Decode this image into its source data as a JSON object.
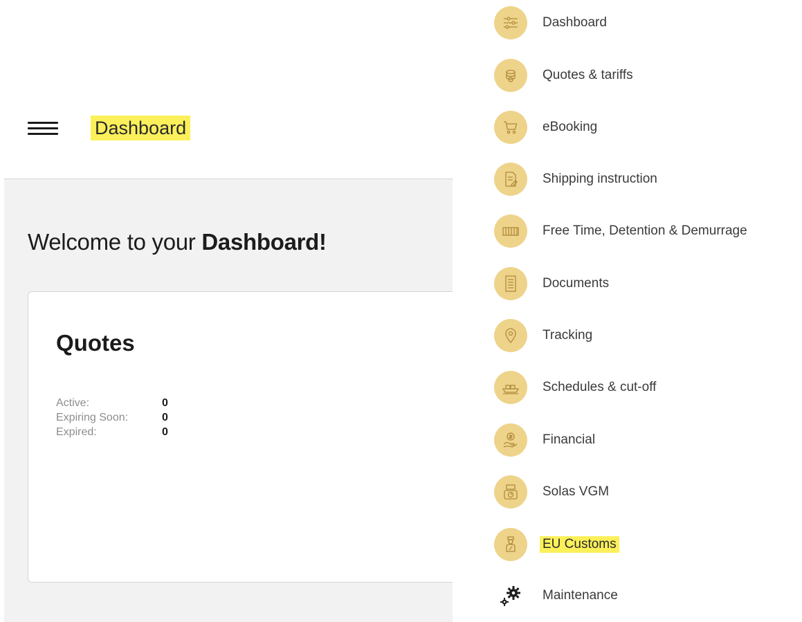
{
  "header": {
    "title": "Dashboard"
  },
  "welcome": {
    "prefix": "Welcome to your ",
    "emphasis": "Dashboard!"
  },
  "quotes_card": {
    "title": "Quotes",
    "stats": [
      {
        "label": "Active:",
        "value": "0"
      },
      {
        "label": "Expiring Soon:",
        "value": "0"
      },
      {
        "label": "Expired:",
        "value": "0"
      }
    ]
  },
  "menu": {
    "items": [
      {
        "label": "Dashboard",
        "icon": "sliders-icon"
      },
      {
        "label": "Quotes & tariffs",
        "icon": "coin-stack-icon"
      },
      {
        "label": "eBooking",
        "icon": "cart-icon"
      },
      {
        "label": "Shipping instruction",
        "icon": "document-edit-icon"
      },
      {
        "label": "Free Time, Detention & Demurrage",
        "icon": "container-icon"
      },
      {
        "label": "Documents",
        "icon": "documents-icon"
      },
      {
        "label": "Tracking",
        "icon": "location-pin-icon"
      },
      {
        "label": "Schedules & cut-off",
        "icon": "ship-icon"
      },
      {
        "label": "Financial",
        "icon": "money-hand-icon"
      },
      {
        "label": "Solas VGM",
        "icon": "scale-icon"
      },
      {
        "label": "EU Customs",
        "icon": "customs-officer-icon",
        "highlighted": true
      },
      {
        "label": "Maintenance",
        "icon": "gears-icon"
      }
    ]
  },
  "colors": {
    "highlight": "#fbf05a",
    "icon_circle": "#eed38a",
    "content_bg": "#f2f2f2"
  }
}
